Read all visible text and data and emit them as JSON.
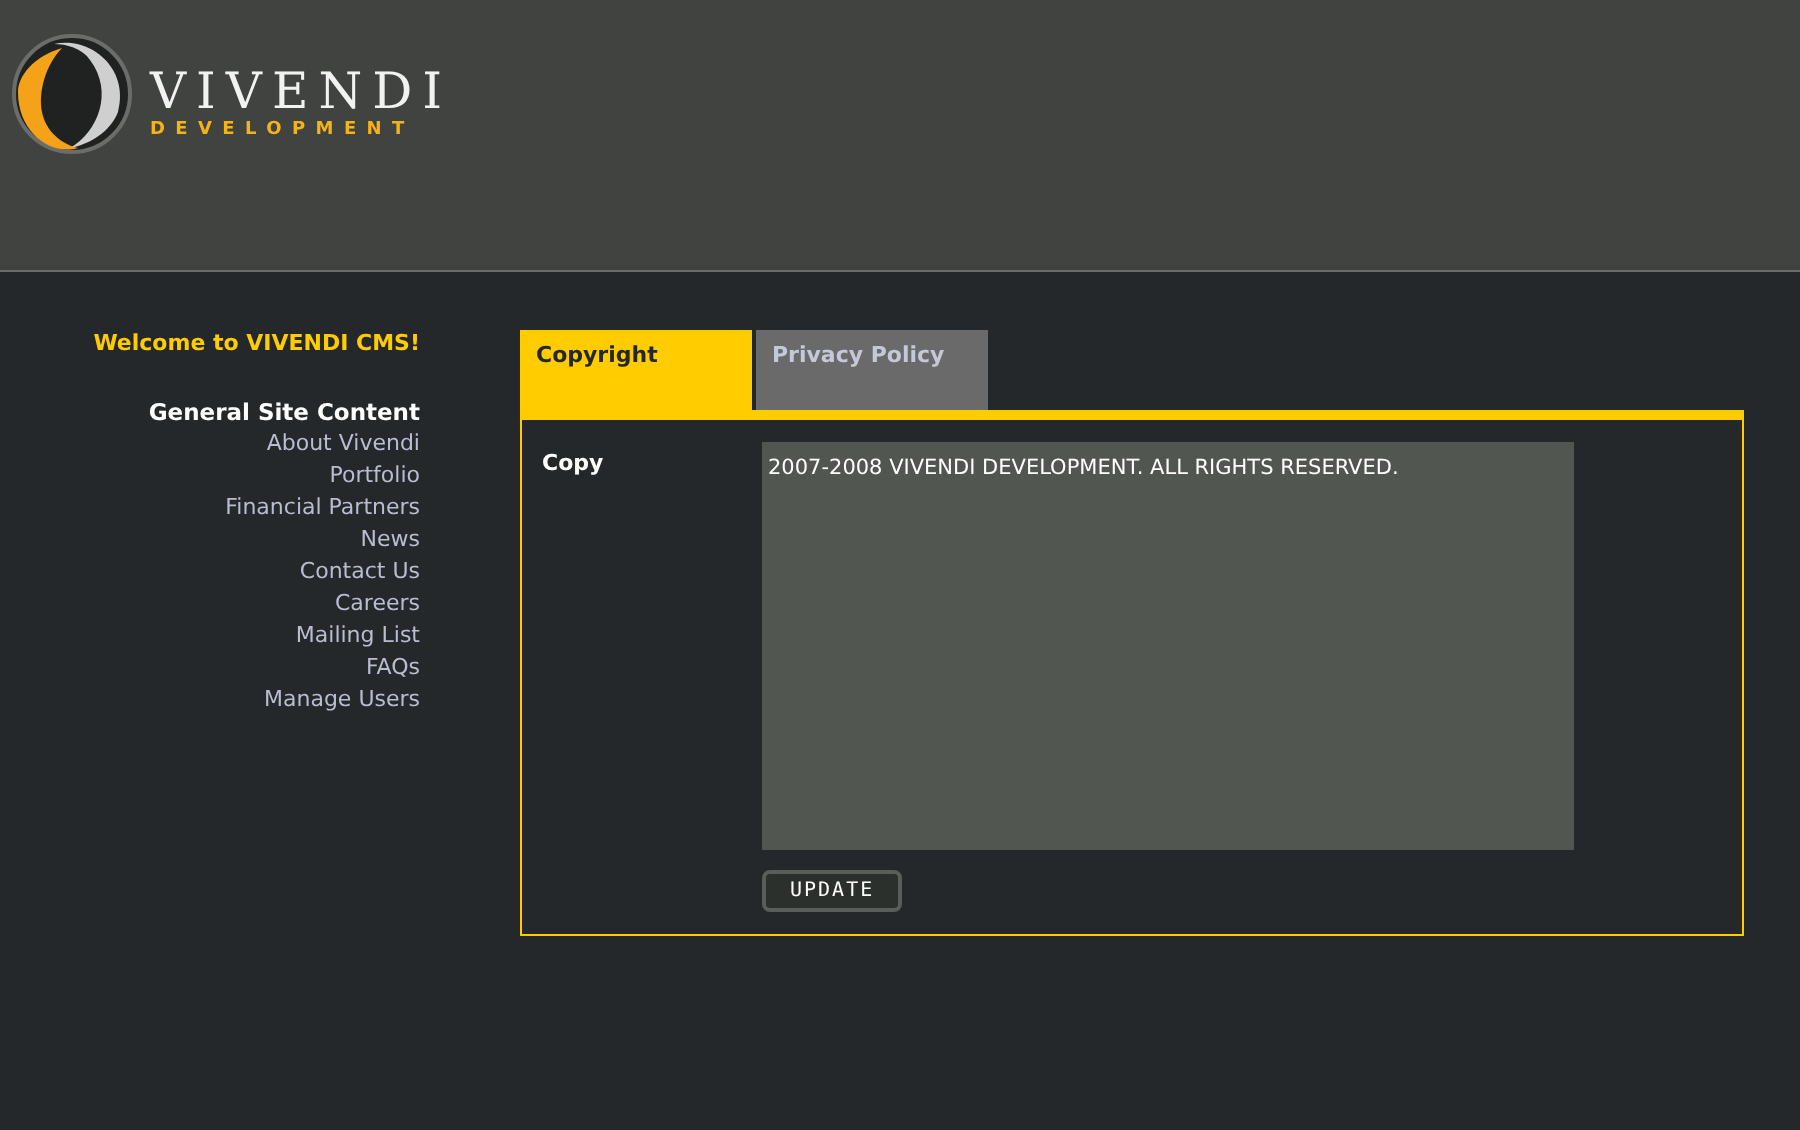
{
  "logo": {
    "name": "VIVENDI",
    "tagline": "DEVELOPMENT"
  },
  "sidebar": {
    "welcome": "Welcome to VIVENDI CMS!",
    "heading": "General Site Content",
    "items": [
      "About Vivendi",
      "Portfolio",
      "Financial Partners",
      "News",
      "Contact Us",
      "Careers",
      "Mailing List",
      "FAQs",
      "Manage Users"
    ]
  },
  "tabs": [
    {
      "label": "Copyright",
      "selected": true
    },
    {
      "label": "Privacy Policy",
      "selected": false
    }
  ],
  "form": {
    "label": "Copy",
    "value": "2007-2008 VIVENDI DEVELOPMENT. ALL RIGHTS RESERVED.",
    "button": "UPDATE"
  }
}
